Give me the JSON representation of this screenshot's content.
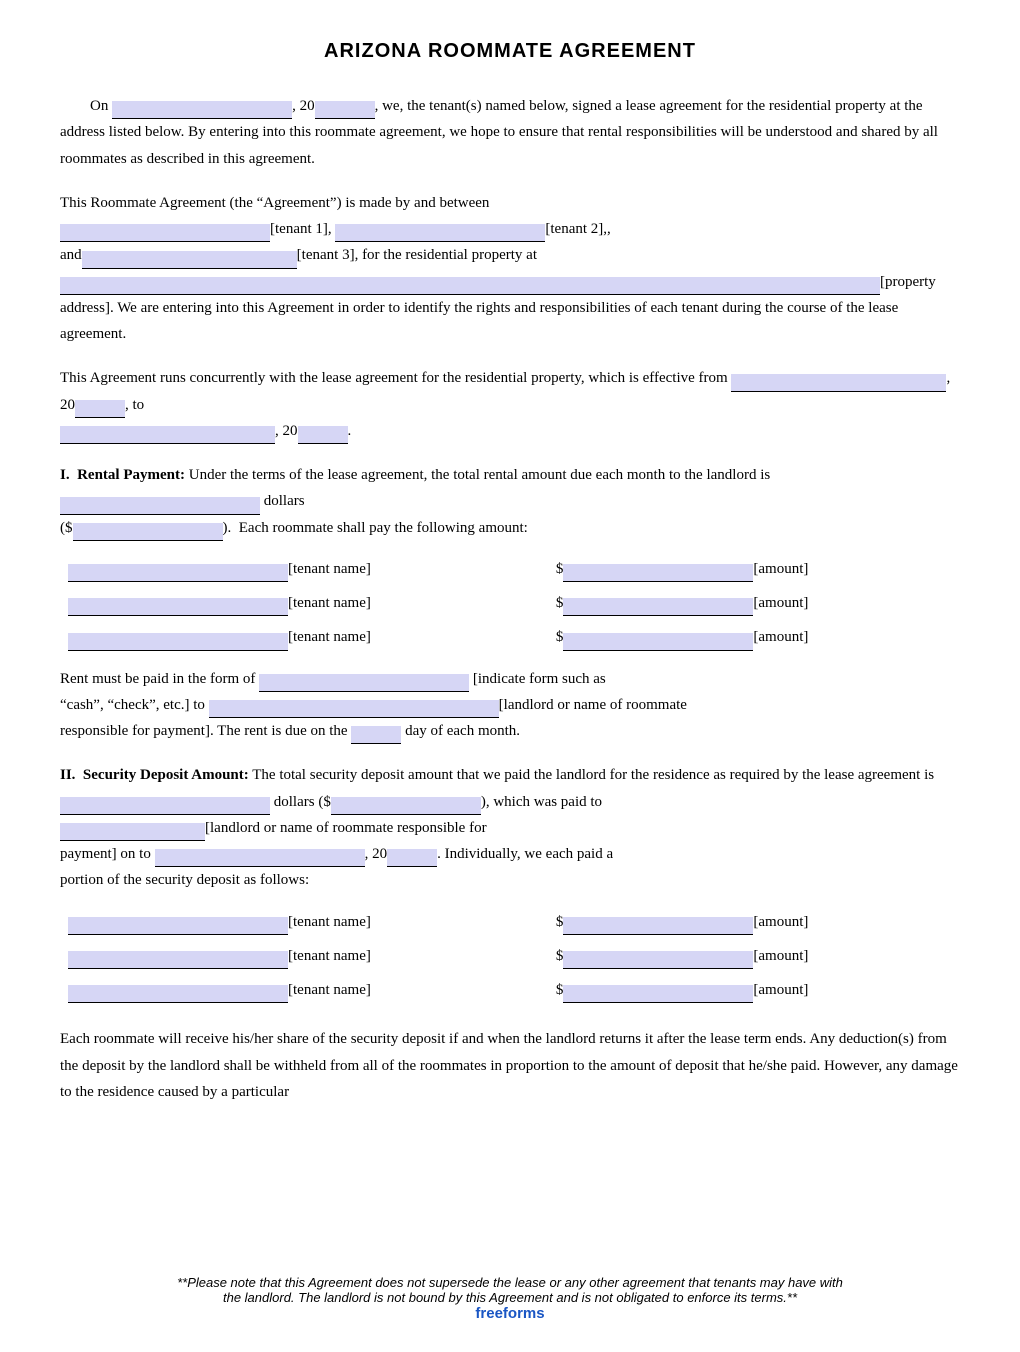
{
  "title": "ARIZONA ROOMMATE AGREEMENT",
  "intro": {
    "line1_before": "On",
    "line1_date_field": "",
    "line1_year_prefix": ", 20",
    "line1_year_field": "",
    "line1_after": ", we, the tenant(s) named below, signed a lease agreement for the residential property at the address listed below. By entering into this roommate agreement, we hope to ensure that rental responsibilities will be understood and shared by all roommates as described in this agreement."
  },
  "parties": {
    "intro": "This Roommate Agreement (the “Agreement”) is made by and between",
    "tenant1_label": "[tenant 1],",
    "tenant2_label": "[tenant 2],,",
    "and_label": "and",
    "tenant3_label": "[tenant 3], for the residential property at",
    "property_label": "[property address]. We are entering into this Agreement in order to identify the rights and responsibilities of each tenant during the course of the lease agreement."
  },
  "effective": {
    "intro": "This Agreement runs concurrently with the lease agreement for the residential property, which is effective from",
    "to_label": "to",
    "year1_prefix": ", 20",
    "year2_prefix": ", 20"
  },
  "rental": {
    "section_num": "I.",
    "title": "Rental Payment:",
    "text1": "Under the terms of the lease agreement, the total rental amount due each month to the landlord is",
    "dollars_label": "dollars",
    "text2": ").  Each roommate shall pay the following amount:",
    "dollar_prefix": "($",
    "tenants": [
      {
        "name_label": "[tenant name]",
        "amount_label": "[amount]"
      },
      {
        "name_label": "[tenant name]",
        "amount_label": "[amount]"
      },
      {
        "name_label": "[tenant name]",
        "amount_label": "[amount]"
      }
    ],
    "rent_form_before": "Rent must be paid in the form of",
    "rent_form_label": "[indicate form such as “cash”, “check”, etc.] to",
    "rent_to_label": "[landlord or name of roommate responsible for payment]. The rent is due on the",
    "day_label": "day of each month."
  },
  "security": {
    "section_num": "II.",
    "title": "Security Deposit Amount:",
    "text1": "The total security deposit amount that we paid the landlord for the residence as required by the lease agreement is",
    "dollars_label": "dollars ($",
    "text2": "), which was paid to",
    "landlord_label": "[landlord or name of roommate responsible for payment] on to",
    "year_prefix": ", 20",
    "text3": ". Individually, we each paid a portion of the security deposit as follows:",
    "tenants": [
      {
        "name_label": "[tenant name]",
        "amount_label": "[amount]"
      },
      {
        "name_label": "[tenant name]",
        "amount_label": "[amount]"
      },
      {
        "name_label": "[tenant name]",
        "amount_label": "[amount]"
      }
    ]
  },
  "closing_para": "Each roommate will receive his/her share of the security deposit if and when the landlord returns it after the lease term ends. Any deduction(s) from the deposit by the landlord shall be withheld from all of the roommates in proportion to the amount of deposit that he/she paid. However, any damage to the residence caused by a particular",
  "footer": {
    "line1": "**Please note that this Agreement does not supersede the lease or any other agreement that tenants may have with",
    "line2": "the landlord. The landlord is not bound by this Agreement and is not obligated to enforce its terms.**",
    "brand": "freeforms"
  }
}
